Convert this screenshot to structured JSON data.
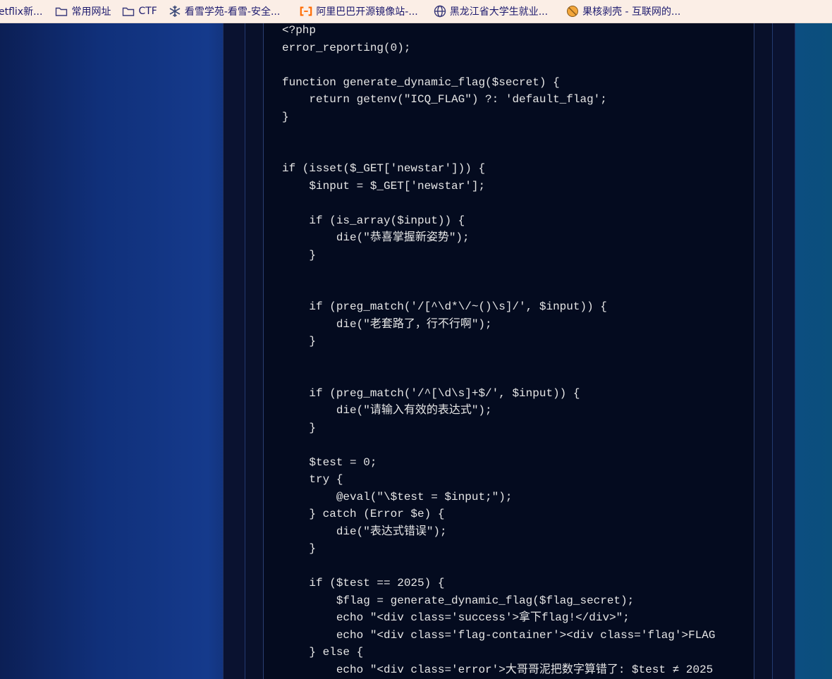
{
  "bookmarks": [
    {
      "icon": "partial",
      "label": "etflix新..."
    },
    {
      "icon": "folder-icon",
      "label": "常用网址"
    },
    {
      "icon": "folder-icon",
      "label": "CTF"
    },
    {
      "icon": "snowflake-icon",
      "label": "看雪学苑-看雪-安全..."
    },
    {
      "icon": "aliyun-icon",
      "label": "阿里巴巴开源镜像站-..."
    },
    {
      "icon": "globe-icon",
      "label": "黑龙江省大学生就业..."
    },
    {
      "icon": "guokr-icon",
      "label": "果核剥壳 - 互联网的..."
    }
  ],
  "code": [
    "<?php",
    "error_reporting(0);",
    "",
    "function generate_dynamic_flag($secret) {",
    "    return getenv(\"ICQ_FLAG\") ?: 'default_flag';",
    "}",
    "",
    "",
    "if (isset($_GET['newstar'])) {",
    "    $input = $_GET['newstar'];",
    "",
    "    if (is_array($input)) {",
    "        die(\"恭喜掌握新姿势\");",
    "    }",
    "",
    "",
    "    if (preg_match('/[^\\d*\\/~()\\s]/', $input)) {",
    "        die(\"老套路了，行不行啊\");",
    "    }",
    "",
    "",
    "    if (preg_match('/^[\\d\\s]+$/', $input)) {",
    "        die(\"请输入有效的表达式\");",
    "    }",
    "",
    "    $test = 0;",
    "    try {",
    "        @eval(\"\\$test = $input;\");",
    "    } catch (Error $e) {",
    "        die(\"表达式错误\");",
    "    }",
    "",
    "    if ($test == 2025) {",
    "        $flag = generate_dynamic_flag($flag_secret);",
    "        echo \"<div class='success'>拿下flag!</div>\";",
    "        echo \"<div class='flag-container'><div class='flag'>FLAG",
    "    } else {",
    "        echo \"<div class='error'>大哥哥泥把数字算错了: $test ≠ 2025"
  ]
}
